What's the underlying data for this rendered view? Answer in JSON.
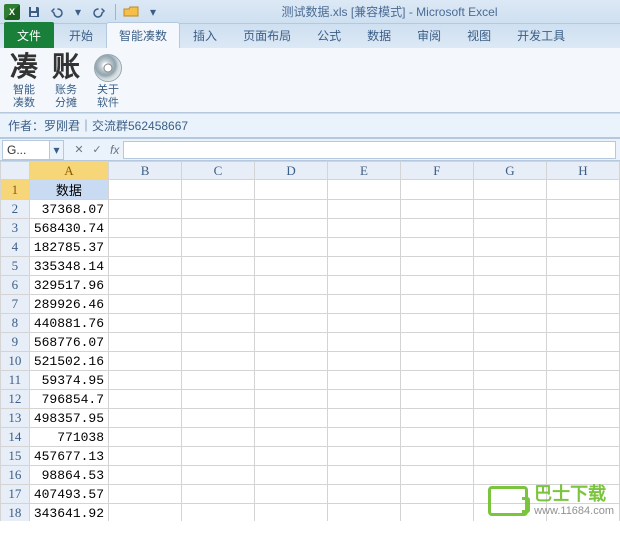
{
  "title": "测试数据.xls  [兼容模式] - Microsoft Excel",
  "app_icon_text": "X",
  "tabs": {
    "file": "文件",
    "items": [
      "开始",
      "智能凑数",
      "插入",
      "页面布局",
      "公式",
      "数据",
      "审阅",
      "视图",
      "开发工具"
    ],
    "active_index": 1
  },
  "ribbon_groups": [
    {
      "big": "凑",
      "lines": [
        "智能",
        "凑数"
      ]
    },
    {
      "big": "账",
      "lines": [
        "账务",
        "分摊"
      ]
    },
    {
      "big": "__CD__",
      "lines": [
        "关于",
        "软件"
      ]
    }
  ],
  "author_bar": "作者：罗刚君｜交流群562458667",
  "namebox": "G...",
  "fx_label": "fx",
  "columns": [
    "A",
    "B",
    "C",
    "D",
    "E",
    "F",
    "G",
    "H"
  ],
  "selected_col_index": 0,
  "rows": [
    {
      "n": 1,
      "a": "数据",
      "sel": true
    },
    {
      "n": 2,
      "a": "37368.07"
    },
    {
      "n": 3,
      "a": "568430.74"
    },
    {
      "n": 4,
      "a": "182785.37"
    },
    {
      "n": 5,
      "a": "335348.14"
    },
    {
      "n": 6,
      "a": "329517.96"
    },
    {
      "n": 7,
      "a": "289926.46"
    },
    {
      "n": 8,
      "a": "440881.76"
    },
    {
      "n": 9,
      "a": "568776.07"
    },
    {
      "n": 10,
      "a": "521502.16"
    },
    {
      "n": 11,
      "a": "59374.95"
    },
    {
      "n": 12,
      "a": "796854.7"
    },
    {
      "n": 13,
      "a": "498357.95"
    },
    {
      "n": 14,
      "a": "771038"
    },
    {
      "n": 15,
      "a": "457677.13"
    },
    {
      "n": 16,
      "a": "98864.53"
    },
    {
      "n": 17,
      "a": "407493.57"
    },
    {
      "n": 18,
      "a": "343641.92"
    }
  ],
  "watermark": {
    "cn": "巴士下载",
    "url": "www.11684.com"
  }
}
